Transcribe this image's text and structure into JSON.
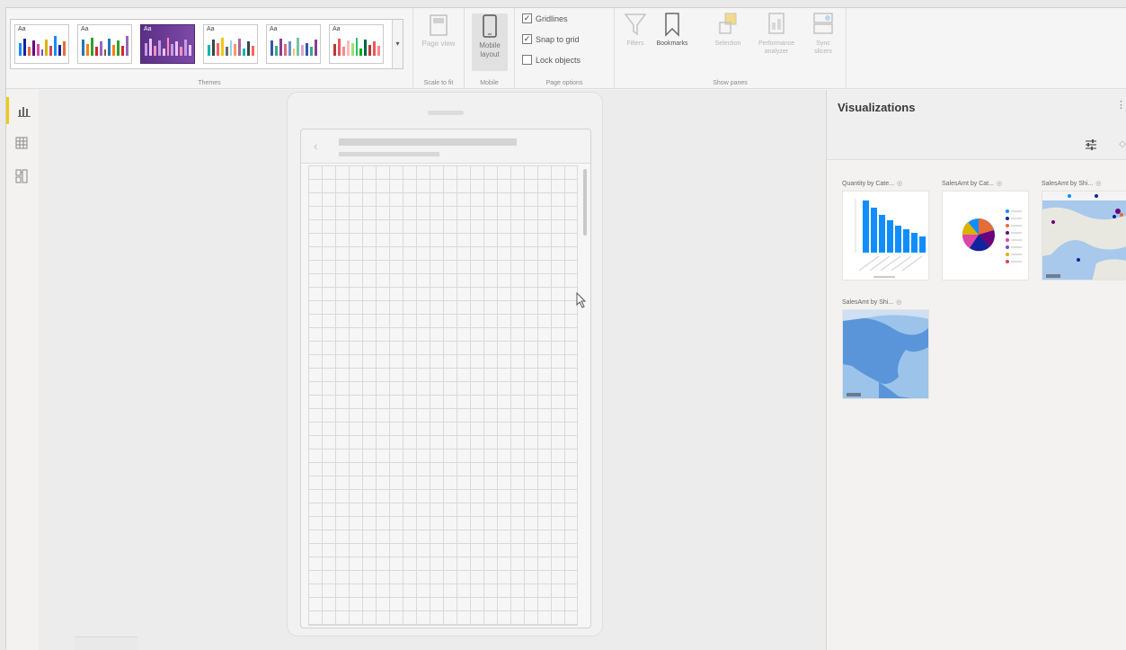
{
  "ribbon": {
    "themes_label": "Themes",
    "theme_swatch_text": "Aa",
    "page_view_label": "Page view",
    "scale_label": "Scale to fit",
    "mobile_layout_label": "Mobile layout",
    "mobile_label": "Mobile",
    "page_options_label": "Page options",
    "gridlines_label": "Gridlines",
    "snap_label": "Snap to grid",
    "lock_label": "Lock objects",
    "gridlines_checked": true,
    "snap_checked": true,
    "lock_checked": false,
    "show_panes_label": "Show panes",
    "panes": [
      "Filters",
      "Bookmarks",
      "Selection",
      "Performance analyzer",
      "Sync slicers"
    ]
  },
  "visualizations": {
    "title": "Visualizations",
    "cards": [
      {
        "title": "Quantity by Cate...",
        "type": "bar-chart"
      },
      {
        "title": "SalesAmt by Cat...",
        "type": "pie-chart"
      },
      {
        "title": "SalesAmt by Shi...",
        "type": "map"
      },
      {
        "title": "SalesAmt by Shi...",
        "type": "map"
      }
    ]
  },
  "colors": {
    "accent_nav": "#f2c811",
    "bar_blue": "#118dff",
    "theme_selected": "#5b2f86"
  },
  "icons": [
    "report-icon",
    "data-icon",
    "model-icon",
    "funnel-icon",
    "bookmark-icon",
    "selection-icon",
    "performance-icon",
    "sync-slicers-icon",
    "page-view-icon",
    "mobile-icon",
    "format-icon",
    "cursor-icon"
  ]
}
